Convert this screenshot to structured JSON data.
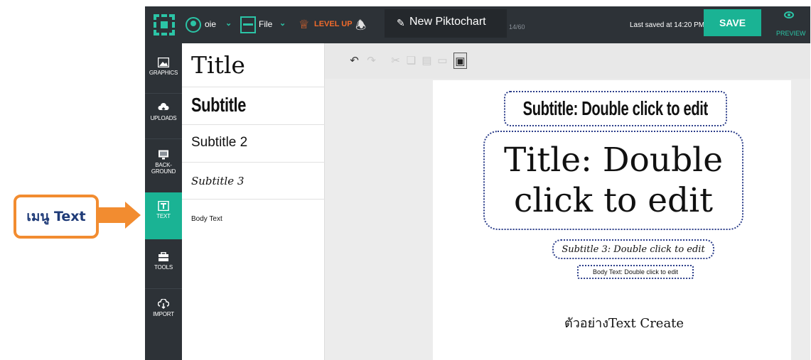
{
  "annotation": {
    "callout_label": "เมนู Text"
  },
  "topbar": {
    "user_name": "oie",
    "file_label": "File",
    "level_up": "LEVEL UP",
    "document_title": "New Piktochart",
    "title_counter": "14/60",
    "last_saved": "Last saved at 14:20 PM",
    "save_label": "SAVE",
    "preview_label": "PREVIEW",
    "icons": [
      "logo-icon",
      "user-icon",
      "file-icon",
      "crown-icon",
      "bell-icon",
      "pencil-icon",
      "eye-icon"
    ]
  },
  "sidebar": {
    "items": [
      {
        "label": "GRAPHICS",
        "icon": "image-icon",
        "active": false
      },
      {
        "label": "UPLOADS",
        "icon": "cloud-upload-icon",
        "active": false
      },
      {
        "label": "BACK-",
        "label2": "GROUND",
        "icon": "monitor-icon",
        "active": false
      },
      {
        "label": "TEXT",
        "icon": "text-icon",
        "active": true
      },
      {
        "label": "TOOLS",
        "icon": "toolbox-icon",
        "active": false
      },
      {
        "label": "IMPORT",
        "icon": "cloud-download-icon",
        "active": false
      }
    ]
  },
  "text_panel": {
    "styles": [
      "Title",
      "Subtitle",
      "Subtitle 2",
      "Subtitle 3",
      "Body Text"
    ]
  },
  "toolbar": {
    "tools": [
      "undo-icon",
      "redo-icon",
      "cut-icon",
      "copy-icon",
      "paste-icon",
      "delete-icon",
      "align-icon"
    ]
  },
  "canvas": {
    "subtitle_text": "Subtitle: Double click to edit",
    "title_text_line1": "Title: Double",
    "title_text_line2": "click to edit",
    "subtitle3_text": "Subtitle 3: Double click to edit",
    "body_text": "Body Text: Double click to edit",
    "caption": "ตัวอย่างText Create"
  },
  "colors": {
    "accent": "#1ab394",
    "topbar": "#2d3237",
    "callout": "#f28c30",
    "level_up": "#f26b2b"
  }
}
